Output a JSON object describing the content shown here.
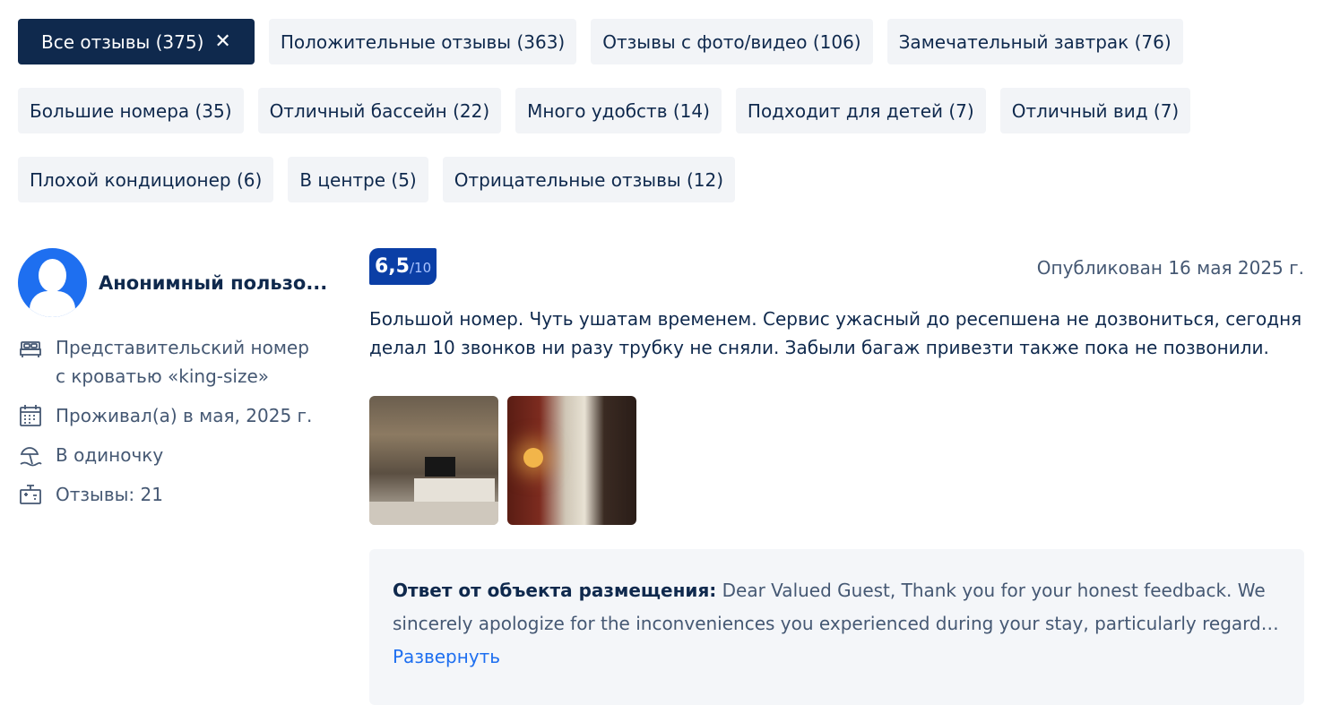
{
  "filters": {
    "rows": [
      [
        {
          "label": "Все отзывы (375)",
          "active": true
        },
        {
          "label": "Положительные отзывы (363)"
        },
        {
          "label": "Отзывы с фото/видео (106)"
        },
        {
          "label": "Замечательный завтрак (76)"
        }
      ],
      [
        {
          "label": "Большие номера (35)"
        },
        {
          "label": "Отличный бассейн (22)"
        },
        {
          "label": "Много удобств (14)"
        },
        {
          "label": "Подходит для детей (7)"
        },
        {
          "label": "Отличный вид (7)"
        }
      ],
      [
        {
          "label": "Плохой кондиционер (6)"
        },
        {
          "label": "В центре (5)"
        },
        {
          "label": "Отрицательные отзывы (12)"
        }
      ]
    ],
    "clear_icon": "✕"
  },
  "user": {
    "name": "Анонимный пользо...",
    "room": "Представительский номер с кроватью «king-size»",
    "stay": "Проживал(а) в мая, 2025 г.",
    "trip_type": "В одиночку",
    "reviews": "Отзывы: 21"
  },
  "review": {
    "score": "6,5",
    "score_max": "/10",
    "published": "Опубликован 16 мая 2025 г.",
    "text": "Большой номер. Чуть ушатам временем. Сервис ужасный до ресепшена не дозвониться, сегодня делал 10 звонков ни разу трубку не сняли. Забыли багаж привезти также пока не позвонили."
  },
  "reply": {
    "label": "Ответ от объекта размещения:",
    "line1": " Dear Valued Guest, Thank you for your honest feedback. We",
    "line2": "sincerely apologize for the inconveniences you experienced during your stay, particularly regarding...",
    "expand": "Развернуть"
  },
  "colors": {
    "accent": "#1e6ff0",
    "dark": "#0f294d",
    "score_bg": "#0b3fa6",
    "chip_bg": "#f2f4f7"
  }
}
